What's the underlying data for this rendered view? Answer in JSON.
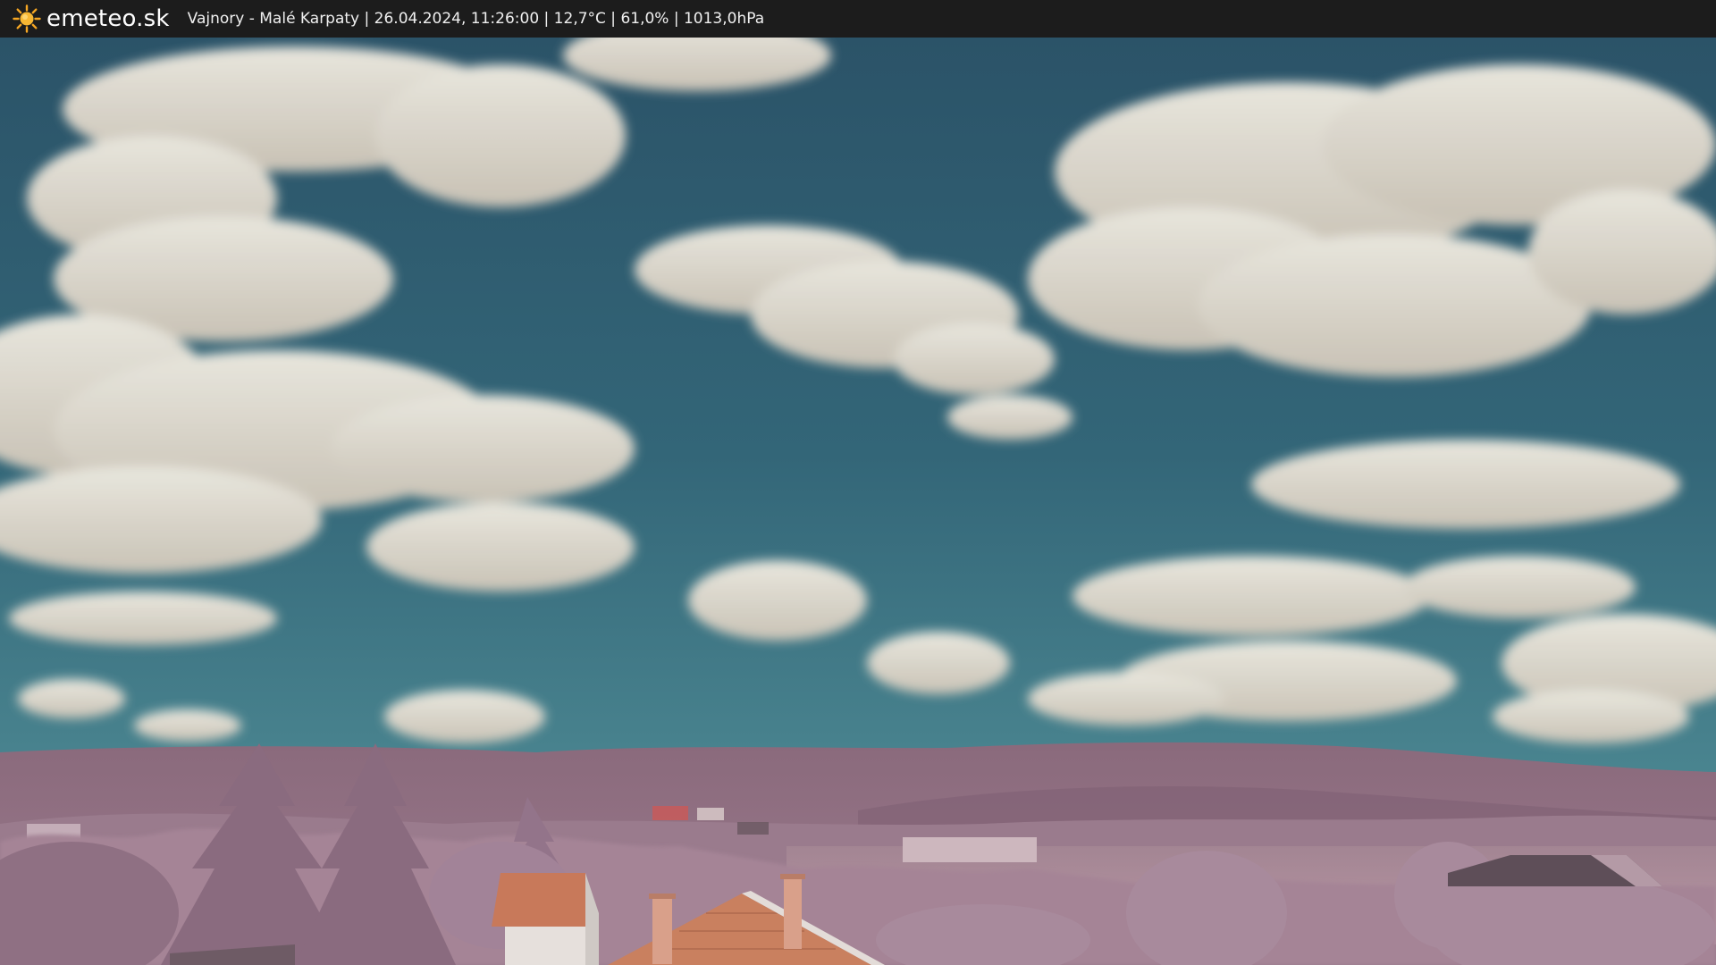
{
  "header": {
    "brand": "emeteo.sk",
    "caption": "Vajnory - Malé Karpaty | 26.04.2024, 11:26:00 | 12,7°C | 61,0% | 1013,0hPa",
    "logo_icon": "sun-icon"
  },
  "colors": {
    "bar": "#1c1c1c",
    "sun": "#f5a623",
    "sky_top": "#2f5a6e",
    "sky_bottom": "#4f8a92",
    "cloud": "#e7e2d6",
    "hills": "#8e6e80",
    "foliage": "#a17f93",
    "roof": "#c67a5a"
  },
  "image": {
    "kind": "webcam-photo"
  }
}
